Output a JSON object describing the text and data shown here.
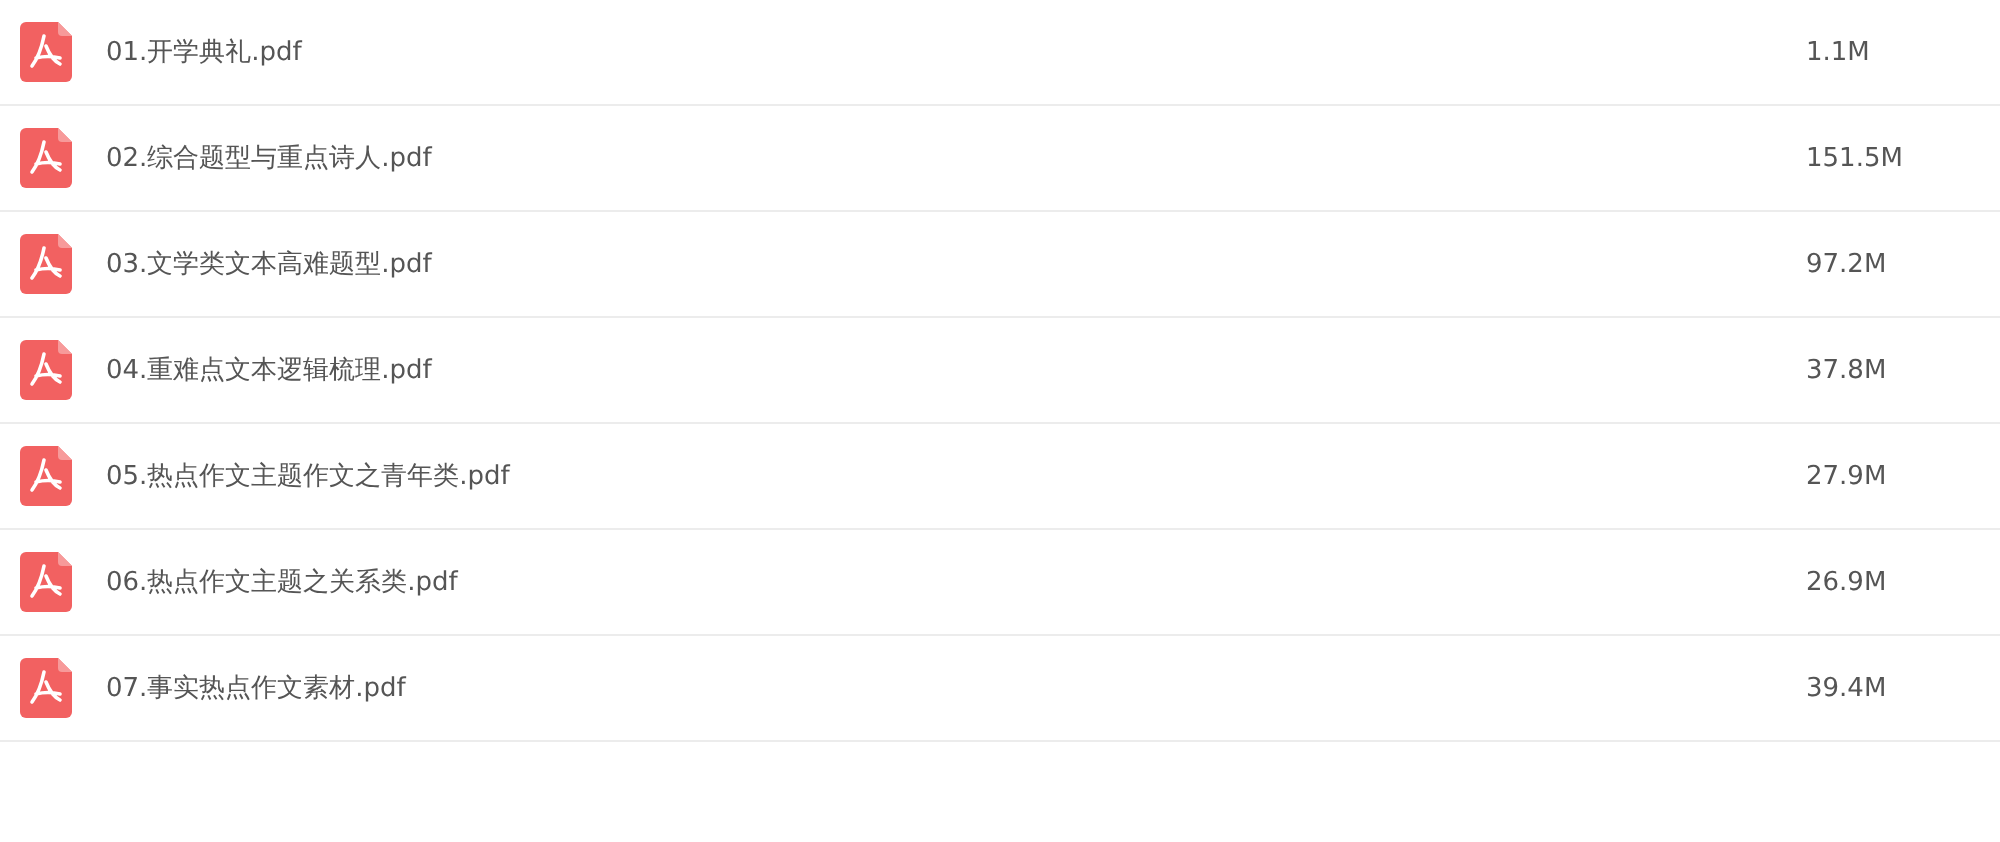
{
  "files": [
    {
      "name": "01.开学典礼.pdf",
      "size": "1.1M"
    },
    {
      "name": "02.综合题型与重点诗人.pdf",
      "size": "151.5M"
    },
    {
      "name": "03.文学类文本高难题型.pdf",
      "size": "97.2M"
    },
    {
      "name": "04.重难点文本逻辑梳理.pdf",
      "size": "37.8M"
    },
    {
      "name": "05.热点作文主题作文之青年类.pdf",
      "size": "27.9M"
    },
    {
      "name": "06.热点作文主题之关系类.pdf",
      "size": "26.9M"
    },
    {
      "name": "07.事实热点作文素材.pdf",
      "size": "39.4M"
    }
  ]
}
